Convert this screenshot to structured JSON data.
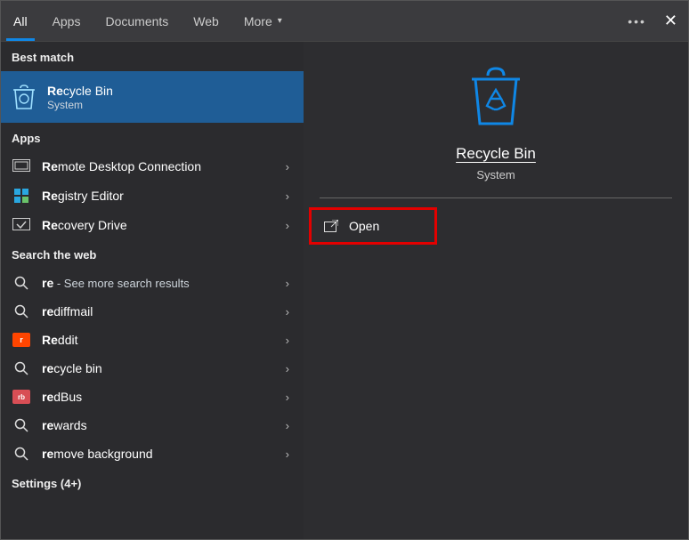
{
  "tabs": {
    "all": "All",
    "apps": "Apps",
    "documents": "Documents",
    "web": "Web",
    "more": "More"
  },
  "sections": {
    "best_match": "Best match",
    "apps": "Apps",
    "search_web": "Search the web",
    "settings": "Settings (4+)"
  },
  "best": {
    "title_prefix": "Re",
    "title_rest": "cycle Bin",
    "subtitle": "System"
  },
  "apps_list": [
    {
      "prefix": "Re",
      "rest": "mote Desktop Connection",
      "icon": "rdc"
    },
    {
      "prefix": "Re",
      "rest": "gistry Editor",
      "icon": "regedit"
    },
    {
      "prefix": "Re",
      "rest": "covery Drive",
      "icon": "recovery"
    }
  ],
  "web_list": [
    {
      "prefix": "re",
      "suffix": " - See more search results",
      "icon": "search"
    },
    {
      "prefix": "re",
      "rest": "diffmail",
      "icon": "search"
    },
    {
      "prefix": "Re",
      "rest": "ddit",
      "icon": "reddit"
    },
    {
      "prefix": "re",
      "rest": "cycle bin",
      "icon": "search"
    },
    {
      "prefix": "re",
      "rest": "dBus",
      "icon": "redbus"
    },
    {
      "prefix": "re",
      "rest": "wards",
      "icon": "search"
    },
    {
      "prefix": "re",
      "rest": "move background",
      "icon": "search"
    }
  ],
  "preview": {
    "title": "Recycle Bin",
    "subtitle": "System"
  },
  "actions": {
    "open": "Open"
  }
}
